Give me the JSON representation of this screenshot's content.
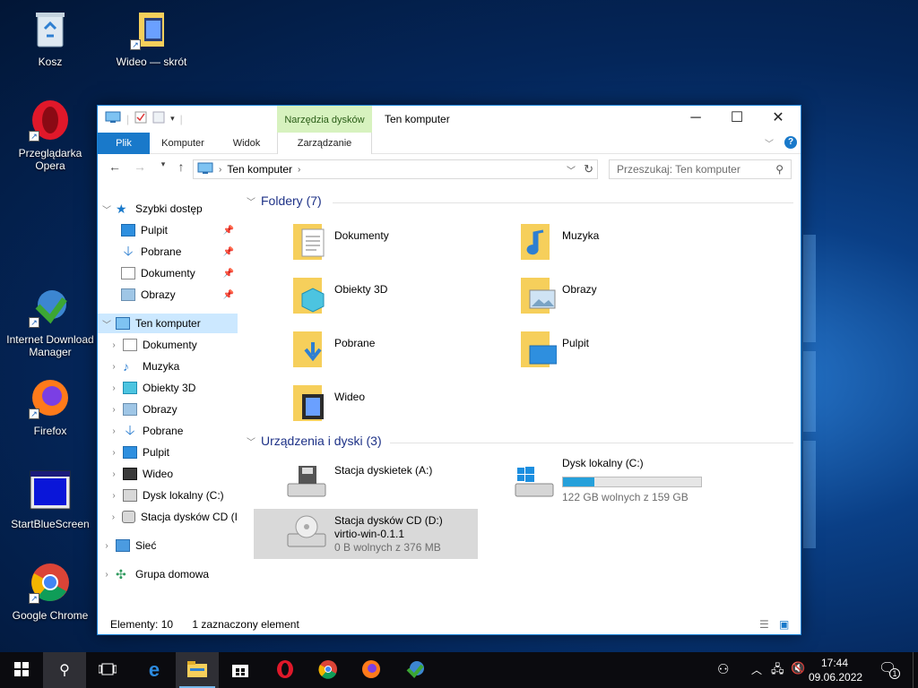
{
  "desktop": {
    "icons": [
      {
        "label": "Kosz",
        "icon": "recycle-bin-icon"
      },
      {
        "label": "Wideo — skrót",
        "icon": "video-folder-shortcut-icon"
      },
      {
        "label": "Przeglądarka Opera",
        "icon": "opera-icon"
      },
      {
        "label": "Internet Download Manager",
        "icon": "idm-icon"
      },
      {
        "label": "Firefox",
        "icon": "firefox-icon"
      },
      {
        "label": "StartBlueScreen",
        "icon": "bluescreen-app-icon"
      },
      {
        "label": "Google Chrome",
        "icon": "chrome-icon"
      }
    ]
  },
  "window": {
    "title": "Ten komputer",
    "context_tab": "Narzędzia dysków",
    "ribbon_tabs": [
      "Plik",
      "Komputer",
      "Widok",
      "Zarządzanie"
    ],
    "address": "Ten komputer",
    "search_placeholder": "Przeszukaj: Ten komputer",
    "colors": {
      "accent": "#1979ca",
      "context_tab_bg": "#d7f2bf",
      "selection": "#cce8ff",
      "header_blue": "#1e3287"
    }
  },
  "nav": {
    "quick_access": "Szybki dostęp",
    "quick_items": [
      "Pulpit",
      "Pobrane",
      "Dokumenty",
      "Obrazy"
    ],
    "this_pc": "Ten komputer",
    "pc_items": [
      "Dokumenty",
      "Muzyka",
      "Obiekty 3D",
      "Obrazy",
      "Pobrane",
      "Pulpit",
      "Wideo",
      "Dysk lokalny (C:)",
      "Stacja dysków CD (I"
    ],
    "network": "Sieć",
    "homegroup": "Grupa domowa"
  },
  "content": {
    "folders_header": "Foldery (7)",
    "folders": [
      "Dokumenty",
      "Muzyka",
      "Obiekty 3D",
      "Obrazy",
      "Pobrane",
      "Pulpit",
      "Wideo"
    ],
    "devices_header": "Urządzenia i dyski (3)",
    "devices": [
      {
        "name": "Stacja dyskietek (A:)"
      },
      {
        "name": "Dysk lokalny (C:)",
        "detail": "122 GB wolnych z 159 GB",
        "used_fraction": 0.23
      },
      {
        "name": "Stacja dysków CD (D:)",
        "label": "virtio-win-0.1.1",
        "detail": "0 B wolnych z 376 MB"
      }
    ]
  },
  "status": {
    "count": "Elementy: 10",
    "selected": "1 zaznaczony element"
  },
  "taskbar": {
    "time": "17:44",
    "date": "09.06.2022",
    "notifications": "1"
  }
}
